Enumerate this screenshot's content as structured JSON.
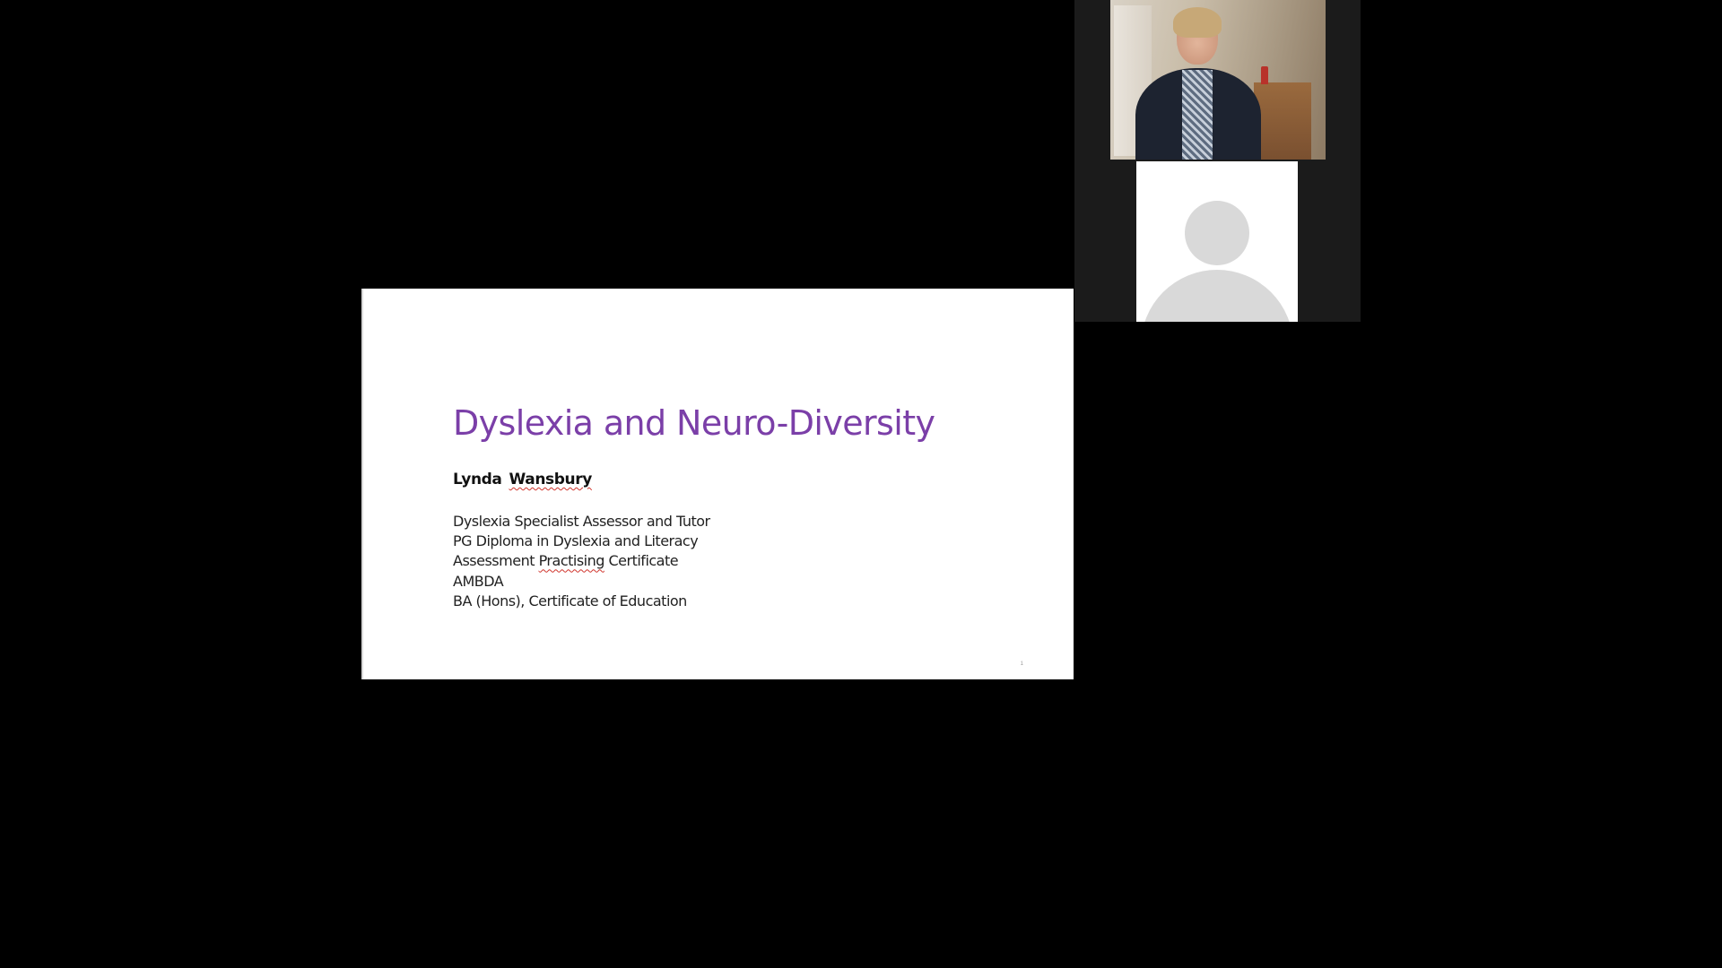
{
  "slide": {
    "title": "Dyslexia and Neuro-Diversity",
    "presenter": {
      "first_name": "Lynda",
      "last_name": "Wansbury"
    },
    "credentials": [
      "Dyslexia Specialist Assessor and Tutor",
      "PG Diploma in Dyslexia and Literacy",
      "Assessment Practising Certificate",
      "AMBDA",
      "BA (Hons), Certificate of Education"
    ],
    "credential_3_parts": {
      "before": "Assessment ",
      "flagged": "Practising",
      "after": " Certificate"
    },
    "slide_number": "1",
    "colors": {
      "title": "#7b3fa8",
      "background": "#ffffff",
      "spellcheck_underline": "#d0342c"
    }
  },
  "video_gallery": {
    "participants": [
      {
        "kind": "camera-video",
        "icon": "presenter-video-feed"
      },
      {
        "kind": "no-video-placeholder",
        "icon": "default-avatar-icon"
      }
    ]
  }
}
